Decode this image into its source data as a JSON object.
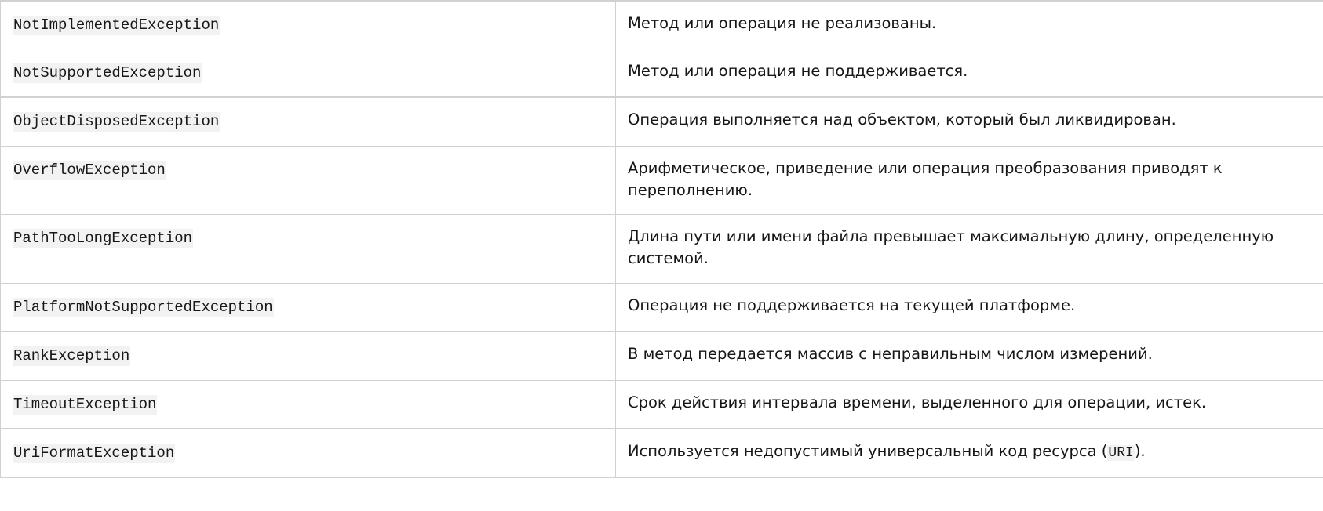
{
  "rows": [
    {
      "name": "NotImplementedException",
      "description": "Метод или операция не реализованы."
    },
    {
      "name": "NotSupportedException",
      "description": "Метод или операция не поддерживается."
    },
    {
      "name": "ObjectDisposedException",
      "description": "Операция выполняется над объектом, который был ликвидирован."
    },
    {
      "name": "OverflowException",
      "description": "Арифметическое, приведение или операция преобразования приводят к переполнению."
    },
    {
      "name": "PathTooLongException",
      "description": "Длина пути или имени файла превышает максимальную длину, определенную системой."
    },
    {
      "name": "PlatformNotSupportedException",
      "description": "Операция не поддерживается на текущей платформе."
    },
    {
      "name": "RankException",
      "description": "В метод передается массив с неправильным числом измерений."
    },
    {
      "name": "TimeoutException",
      "description": "Срок действия интервала времени, выделенного для операции, истек."
    },
    {
      "name": "UriFormatException",
      "description_before": "Используется недопустимый универсальный код ресурса (",
      "description_code": "URI",
      "description_after": ")."
    }
  ]
}
